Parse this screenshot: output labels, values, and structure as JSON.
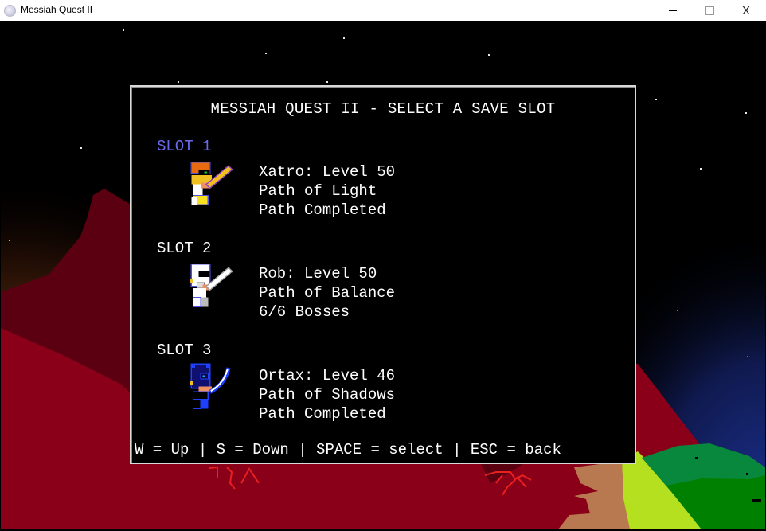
{
  "window": {
    "title": "Messiah Quest II",
    "app_icon": "moon-app-icon",
    "buttons": {
      "minimize": "minimize-icon",
      "maximize": "maximize-icon",
      "close": "close-icon"
    },
    "close_glyph": "X"
  },
  "menu": {
    "heading": "MESSIAH QUEST II - SELECT A SAVE SLOT",
    "selected_slot": 1,
    "selected_color": "#6a6aef",
    "slots": [
      {
        "label": "SLOT 1",
        "character": "Xatro",
        "line1": "Xatro: Level 50",
        "line2": "Path of Light",
        "line3": "Path Completed",
        "sprite": "gold-armored-warrior-sprite",
        "level": 50
      },
      {
        "label": "SLOT 2",
        "character": "Rob",
        "line1": "Rob: Level 50",
        "line2": "Path of Balance",
        "line3": "6/6 Bosses",
        "sprite": "white-armored-knight-sprite",
        "level": 50
      },
      {
        "label": "SLOT 3",
        "character": "Ortax",
        "line1": "Ortax: Level 46",
        "line2": "Path of Shadows",
        "line3": "Path Completed",
        "sprite": "blue-shadow-warrior-sprite",
        "level": 46
      }
    ],
    "controls": "W = Up | S = Down | SPACE = select | ESC = back"
  },
  "scene": {
    "sky_top": "#000000",
    "sky_left_glow": "#8a4a1a",
    "sky_right_glow": "#1a2a78",
    "mountain_dark": "#5a0010",
    "ground_red": "#8a0018",
    "lava_crack": "#e82020",
    "path_brown": "#b87850",
    "grass_lime": "#b4e020",
    "hill_green": "#08883c",
    "hill_dark_green": "#008000"
  }
}
